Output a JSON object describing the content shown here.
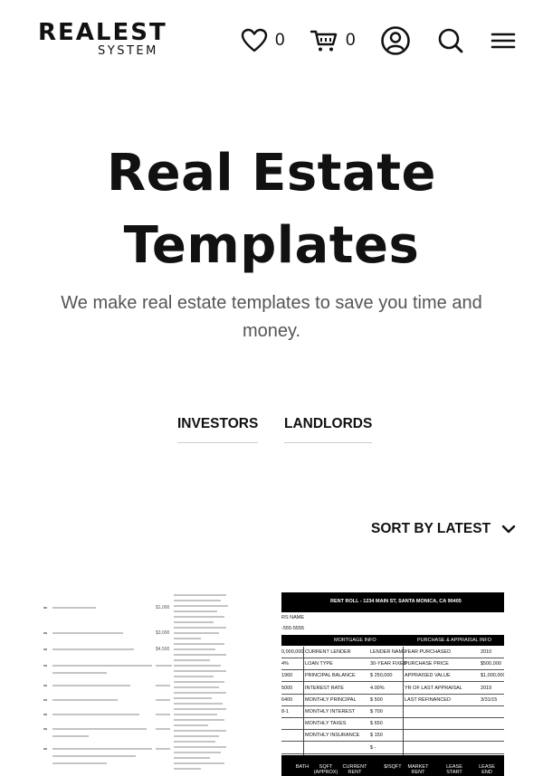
{
  "header": {
    "logo_main": "REALEST",
    "logo_sub": "SYSTEM",
    "wishlist_count": "0",
    "cart_count": "0",
    "icons": [
      "heart-icon",
      "cart-icon",
      "account-icon",
      "search-icon",
      "menu-icon"
    ]
  },
  "hero": {
    "title": "Real Estate Templates",
    "subtitle": "We make real estate templates to save you time and money."
  },
  "tabs": [
    {
      "label": "INVESTORS"
    },
    {
      "label": "LANDLORDS"
    }
  ],
  "sort": {
    "label": "SORT BY LATEST"
  },
  "products": [
    {
      "doc_values": [
        "$1,000",
        "$3,000",
        "$4,500"
      ]
    },
    {
      "sheet_title": "RENT ROLL - 1234 MAIN ST, SANTA MONICA, CA 90405",
      "section_headers": [
        "MORTGAGE INFO",
        "PURCHASE & APPRAISAL INFO"
      ],
      "left_stub": [
        "RS NAME",
        "-555-5555",
        "0,000,000",
        "4%",
        "1960",
        "5000",
        "6400",
        "8-1"
      ],
      "rows": [
        {
          "label": "CURRENT LENDER",
          "value": "LENDER NAME",
          "label2": "YEAR PURCHASED",
          "value2": "2010"
        },
        {
          "label": "LOAN TYPE",
          "value": "30-YEAR FIXED",
          "label2": "PURCHASE PRICE",
          "value2": "$500,000"
        },
        {
          "label": "PRINCIPAL BALANCE",
          "value": "$ 250,000",
          "label2": "APPRAISED VALUE",
          "value2": "$1,000,000"
        },
        {
          "label": "INTEREST RATE",
          "value": "4.00%",
          "label2": "YR OF LAST APPRAISAL",
          "value2": "2019"
        },
        {
          "label": "MONTHLY PRINCIPAL",
          "value": "$ 500",
          "label2": "LAST REFINANCED",
          "value2": "3/31/15"
        },
        {
          "label": "MONTHLY INTEREST",
          "value": "$ 700",
          "label2": "",
          "value2": ""
        },
        {
          "label": "MONTHLY TAXES",
          "value": "$ 650",
          "label2": "",
          "value2": ""
        },
        {
          "label": "MONTHLY INSURANCE",
          "value": "$ 150",
          "label2": "",
          "value2": ""
        },
        {
          "label": "",
          "value": "$ -",
          "label2": "",
          "value2": ""
        }
      ],
      "footer_headers": [
        "BATH",
        "SQFT (APPROX)",
        "CURRENT RENT",
        "$/SQFT",
        "MARKET RENT",
        "LEASE START",
        "LEASE END"
      ]
    }
  ]
}
